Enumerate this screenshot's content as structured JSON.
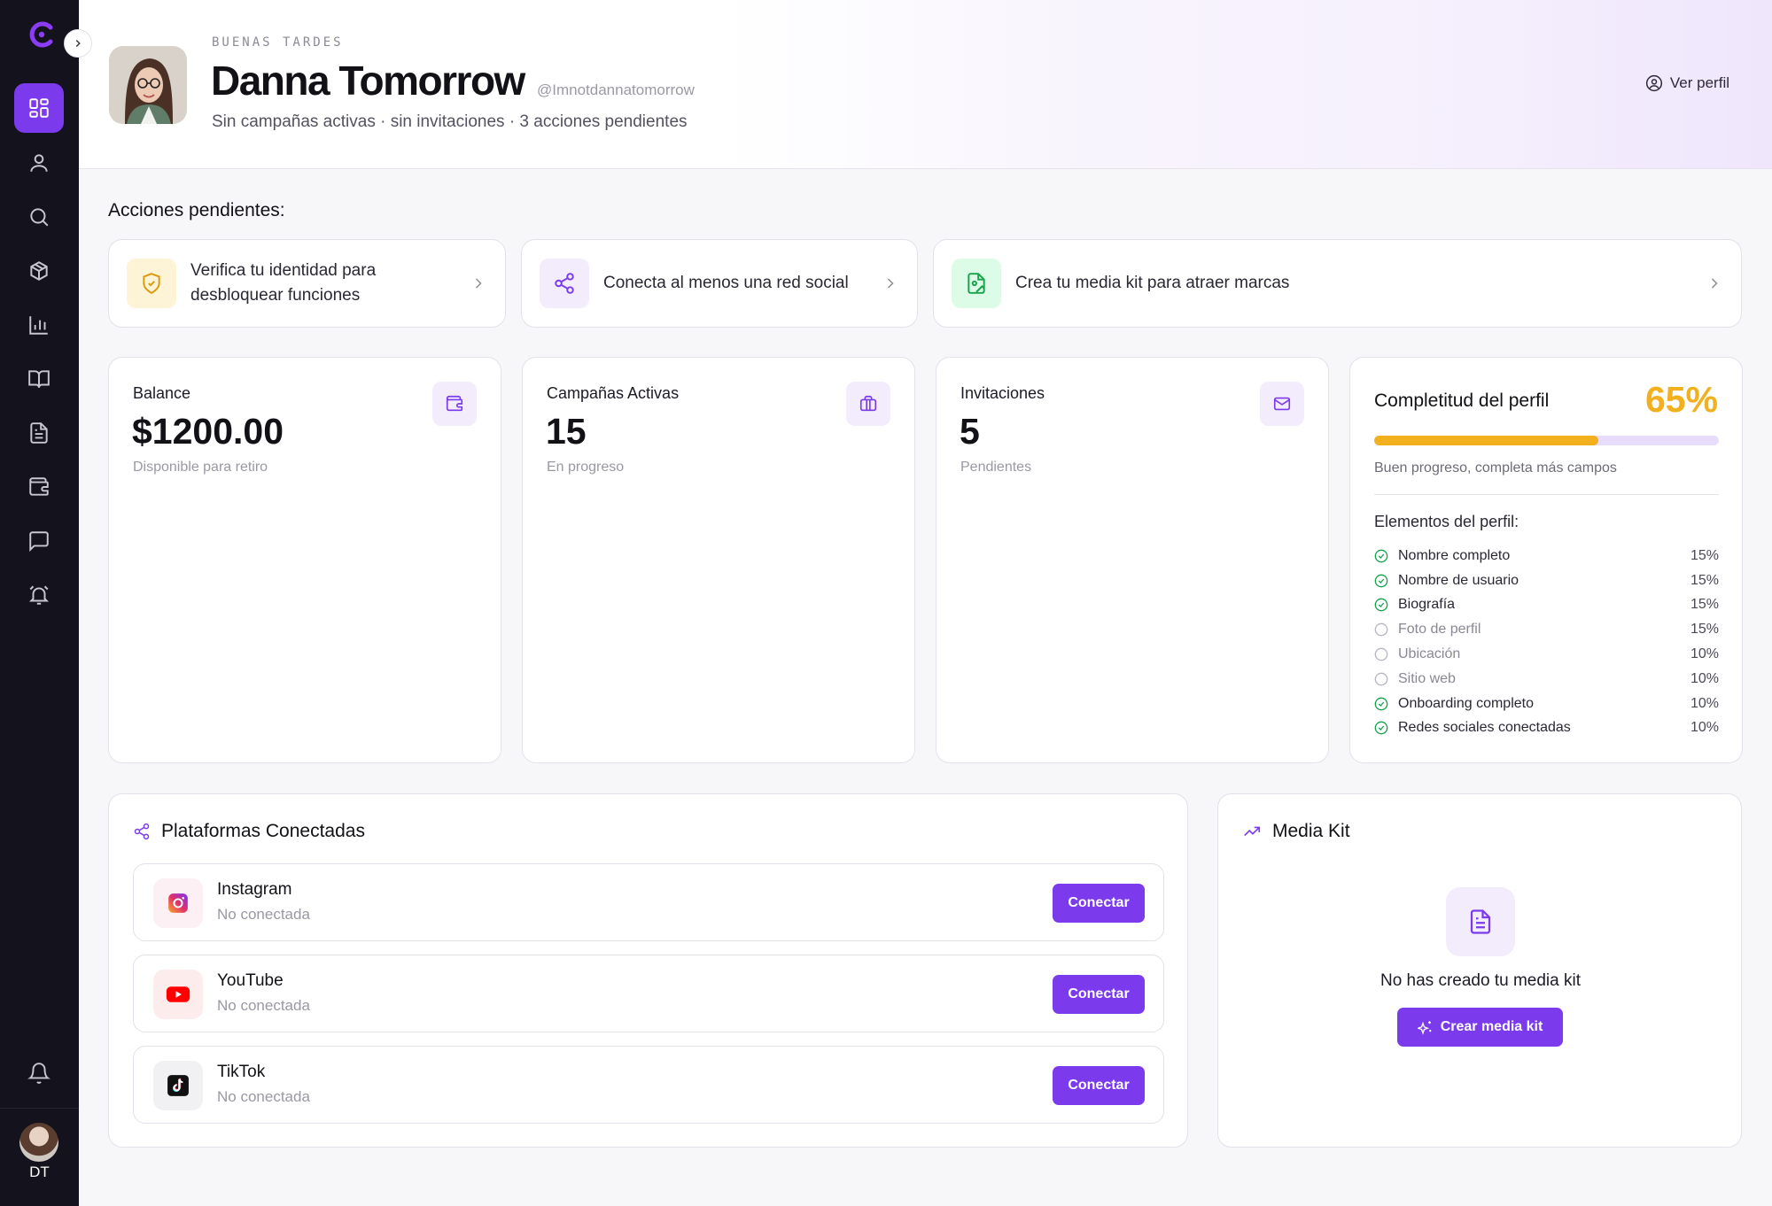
{
  "sidebar": {
    "logo": "c-logo-icon",
    "items": [
      {
        "name": "dashboard",
        "icon": "grid-icon",
        "active": true
      },
      {
        "name": "profile",
        "icon": "user-icon"
      },
      {
        "name": "search",
        "icon": "search-icon"
      },
      {
        "name": "campaigns",
        "icon": "box-icon"
      },
      {
        "name": "analytics",
        "icon": "bar-chart-icon"
      },
      {
        "name": "guides",
        "icon": "book-icon"
      },
      {
        "name": "documents",
        "icon": "document-icon"
      },
      {
        "name": "wallet",
        "icon": "wallet-icon"
      },
      {
        "name": "messages",
        "icon": "chat-icon"
      },
      {
        "name": "alerts",
        "icon": "alarm-bell-icon"
      }
    ],
    "bottom_icon": "bell-icon",
    "user_initials": "DT"
  },
  "header": {
    "greeting": "BUENAS TARDES",
    "name": "Danna Tomorrow",
    "handle": "@Imnotdannatomorrow",
    "subtitle": "Sin campañas activas · sin invitaciones · 3 acciones pendientes",
    "view_profile": "Ver perfil"
  },
  "pending": {
    "title": "Acciones pendientes:",
    "items": [
      {
        "text": "Verifica tu identidad para desbloquear funciones",
        "icon": "shield-check-icon",
        "color": "#d99a0b",
        "bg": "#fdf3d7"
      },
      {
        "text": "Conecta al menos una red social",
        "icon": "share-icon",
        "color": "#7c3aed",
        "bg": "#f2ecfd"
      },
      {
        "text": "Crea tu media kit para atraer marcas",
        "icon": "file-image-icon",
        "color": "#16a34a",
        "bg": "#dcfce7"
      }
    ]
  },
  "stats": [
    {
      "label": "Balance",
      "value": "$1200.00",
      "note": "Disponible para retiro",
      "icon": "wallet-icon"
    },
    {
      "label": "Campañas Activas",
      "value": "15",
      "note": "En progreso",
      "icon": "briefcase-icon"
    },
    {
      "label": "Invitaciones",
      "value": "5",
      "note": "Pendientes",
      "icon": "mail-icon"
    }
  ],
  "completeness": {
    "title": "Completitud del perfil",
    "percent_text": "65%",
    "percent": 65,
    "note": "Buen progreso, completa más campos",
    "subtitle": "Elementos del perfil:",
    "items": [
      {
        "label": "Nombre completo",
        "pct": "15%",
        "done": true
      },
      {
        "label": "Nombre de usuario",
        "pct": "15%",
        "done": true
      },
      {
        "label": "Biografía",
        "pct": "15%",
        "done": true
      },
      {
        "label": "Foto de perfil",
        "pct": "15%",
        "done": false
      },
      {
        "label": "Ubicación",
        "pct": "10%",
        "done": false
      },
      {
        "label": "Sitio web",
        "pct": "10%",
        "done": false
      },
      {
        "label": "Onboarding completo",
        "pct": "10%",
        "done": true
      },
      {
        "label": "Redes sociales conectadas",
        "pct": "10%",
        "done": true
      }
    ],
    "colors": {
      "done": "#16a34a",
      "pending": "#b7b5bf",
      "accent": "#f2b01e"
    }
  },
  "platforms": {
    "title": "Plataformas Conectadas",
    "items": [
      {
        "name": "Instagram",
        "status": "No conectada",
        "button": "Conectar",
        "icon": "instagram-icon"
      },
      {
        "name": "YouTube",
        "status": "No conectada",
        "button": "Conectar",
        "icon": "youtube-icon"
      },
      {
        "name": "TikTok",
        "status": "No conectada",
        "button": "Conectar",
        "icon": "tiktok-icon"
      }
    ]
  },
  "media_kit": {
    "title": "Media Kit",
    "empty_text": "No has creado tu media kit",
    "button": "Crear media kit"
  },
  "colors": {
    "brand": "#7c3aed",
    "sidebar_bg": "#14121c"
  }
}
